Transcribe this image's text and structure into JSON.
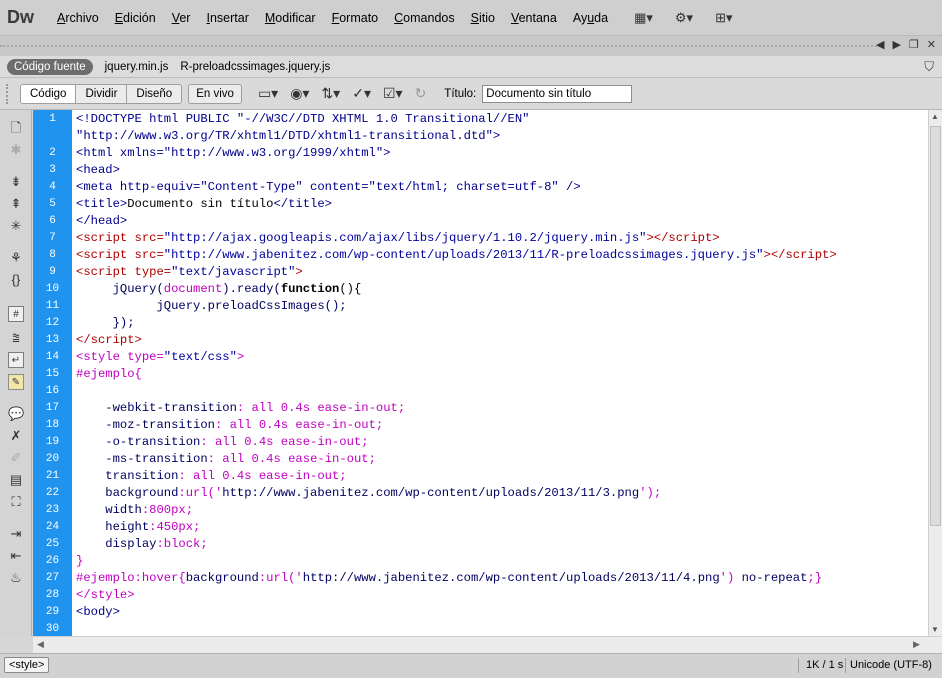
{
  "app": {
    "logo": "Dw"
  },
  "menu": [
    {
      "pre": "",
      "u": "A",
      "post": "rchivo"
    },
    {
      "pre": "",
      "u": "E",
      "post": "dición"
    },
    {
      "pre": "",
      "u": "V",
      "post": "er"
    },
    {
      "pre": "",
      "u": "I",
      "post": "nsertar"
    },
    {
      "pre": "",
      "u": "M",
      "post": "odificar"
    },
    {
      "pre": "",
      "u": "F",
      "post": "ormato"
    },
    {
      "pre": "",
      "u": "C",
      "post": "omandos"
    },
    {
      "pre": "",
      "u": "S",
      "post": "itio"
    },
    {
      "pre": "",
      "u": "V",
      "post": "entana"
    },
    {
      "pre": "Ay",
      "u": "u",
      "post": "da"
    }
  ],
  "menu_icons": [
    "layout-icon",
    "gear-icon",
    "sitemap-icon"
  ],
  "related": {
    "source_label": "Código fuente",
    "files": [
      "jquery.min.js",
      "R-preloadcssimages.jquery.js"
    ]
  },
  "toolbar": {
    "views": [
      "Código",
      "Dividir",
      "Diseño"
    ],
    "active_view": "Código",
    "live_label": "En vivo",
    "title_label": "Título:",
    "title_value": "Documento sin título"
  },
  "code_lines": [
    {
      "n": "1",
      "html": "<span class=\"tag\">&lt;!DOCTYPE html PUBLIC \"-//W3C//DTD XHTML 1.0 Transitional//EN\"</span>"
    },
    {
      "n": "",
      "html": "<span class=\"tag\">\"http://www.w3.org/TR/xhtml1/DTD/xhtml1-transitional.dtd\"&gt;</span>"
    },
    {
      "n": "2",
      "html": "<span class=\"tag\">&lt;html xmlns=\"http://www.w3.org/1999/xhtml\"&gt;</span>"
    },
    {
      "n": "3",
      "html": "<span class=\"tag\">&lt;head&gt;</span>"
    },
    {
      "n": "4",
      "html": "<span class=\"tag\">&lt;meta http-equiv=\"Content-Type\" content=\"text/html; charset=utf-8\" /&gt;</span>"
    },
    {
      "n": "5",
      "html": "<span class=\"tag\">&lt;title&gt;</span><span class=\"blk\">Documento sin título</span><span class=\"tag\">&lt;/title&gt;</span>"
    },
    {
      "n": "6",
      "html": "<span class=\"tag\">&lt;/head&gt;</span>"
    },
    {
      "n": "7",
      "html": "<span class=\"red\">&lt;script src=</span><span class=\"rstr\">\"http://ajax.googleapis.com/ajax/libs/jquery/1.10.2/jquery.min.js\"</span><span class=\"red\">&gt;&lt;/script&gt;</span>"
    },
    {
      "n": "8",
      "html": "<span class=\"red\">&lt;script src=</span><span class=\"rstr\">\"http://www.jabenitez.com/wp-content/uploads/2013/11/R-preloadcssimages.jquery.js\"</span><span class=\"red\">&gt;&lt;/script&gt;</span>"
    },
    {
      "n": "9",
      "html": "<span class=\"red\">&lt;script type=</span><span class=\"rstr\">\"text/javascript\"</span><span class=\"red\">&gt;</span>"
    },
    {
      "n": "10",
      "html": "     <span class=\"dk\">jQuery(</span><span class=\"mag\">document</span><span class=\"dk\">).ready(</span><span class=\"blk\"><b>function</b>(){</span>"
    },
    {
      "n": "11",
      "html": "           <span class=\"dk\">jQuery.preloadCssImages();</span>"
    },
    {
      "n": "12",
      "html": "     <span class=\"dk\">});</span>"
    },
    {
      "n": "13",
      "html": "<span class=\"red\">&lt;/script&gt;</span>"
    },
    {
      "n": "14",
      "html": "<span class=\"mag\">&lt;style type=</span><span class=\"rstr\">\"text/css\"</span><span class=\"mag\">&gt;</span>"
    },
    {
      "n": "15",
      "html": "<span class=\"mag\">#ejemplo{</span>"
    },
    {
      "n": "16",
      "html": ""
    },
    {
      "n": "17",
      "html": "    <span class=\"dk\">-webkit-transition</span><span class=\"mag\">: all 0.4s ease-in-out;</span>"
    },
    {
      "n": "18",
      "html": "    <span class=\"dk\">-moz-transition</span><span class=\"mag\">: all 0.4s ease-in-out;</span>"
    },
    {
      "n": "19",
      "html": "    <span class=\"dk\">-o-transition</span><span class=\"mag\">: all 0.4s ease-in-out;</span>"
    },
    {
      "n": "20",
      "html": "    <span class=\"dk\">-ms-transition</span><span class=\"mag\">: all 0.4s ease-in-out;</span>"
    },
    {
      "n": "21",
      "html": "    <span class=\"dk\">transition</span><span class=\"mag\">: all 0.4s ease-in-out;</span>"
    },
    {
      "n": "22",
      "html": "    <span class=\"dk\">background</span><span class=\"mag\">:url('</span><span class=\"dk\">http://www.jabenitez.com/wp-content/uploads/2013/11/3.png</span><span class=\"mag\">');</span>"
    },
    {
      "n": "23",
      "html": "    <span class=\"dk\">width</span><span class=\"mag\">:800px;</span>"
    },
    {
      "n": "24",
      "html": "    <span class=\"dk\">height</span><span class=\"mag\">:450px;</span>"
    },
    {
      "n": "25",
      "html": "    <span class=\"dk\">display</span><span class=\"mag\">:block;</span>"
    },
    {
      "n": "26",
      "html": "<span class=\"mag\">}</span>"
    },
    {
      "n": "27",
      "html": "<span class=\"mag\">#ejemplo:hover{</span><span class=\"dk\">background</span><span class=\"mag\">:url('</span><span class=\"dk\">http://www.jabenitez.com/wp-content/uploads/2013/11/4.png</span><span class=\"mag\">') </span><span class=\"dk\">no-repeat</span><span class=\"mag\">;}</span>"
    },
    {
      "n": "28",
      "html": "<span class=\"mag\">&lt;/style&gt;</span>"
    },
    {
      "n": "29",
      "html": "<span class=\"tag\">&lt;body&gt;</span>"
    },
    {
      "n": "30",
      "html": ""
    }
  ],
  "status": {
    "tag_selector": "<style>",
    "size_time": "1K / 1 s",
    "encoding": "Unicode (UTF-8)"
  }
}
